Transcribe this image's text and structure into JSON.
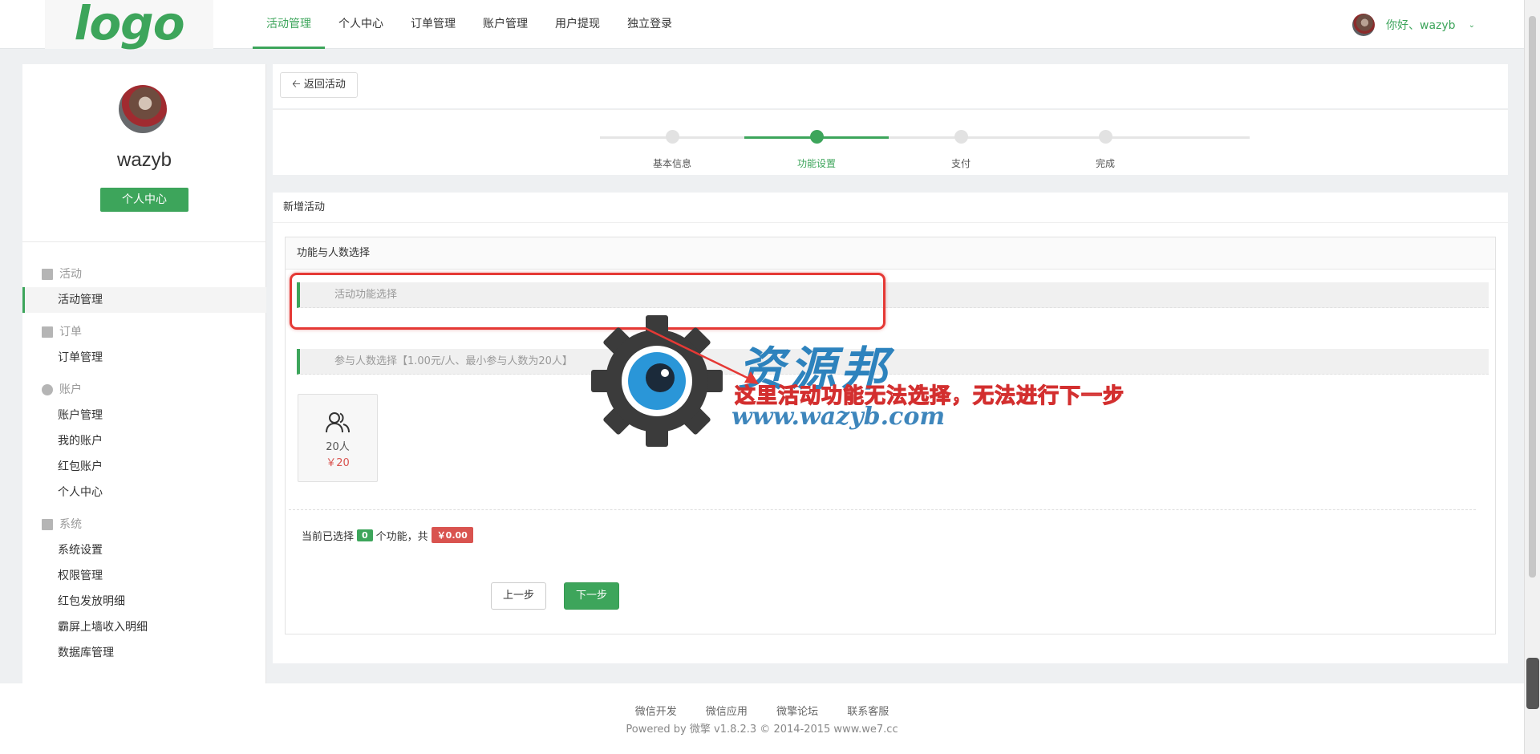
{
  "logo": "logo",
  "nav": [
    "活动管理",
    "个人中心",
    "订单管理",
    "账户管理",
    "用户提现",
    "独立登录"
  ],
  "user_greeting": "你好、wazyb",
  "profile": {
    "name": "wazyb",
    "button": "个人中心"
  },
  "sidebar": {
    "groups": [
      {
        "label": "活动",
        "items": [
          "活动管理"
        ]
      },
      {
        "label": "订单",
        "items": [
          "订单管理"
        ]
      },
      {
        "label": "账户",
        "items": [
          "账户管理",
          "我的账户",
          "红包账户",
          "个人中心"
        ]
      },
      {
        "label": "系统",
        "items": [
          "系统设置",
          "权限管理",
          "红包发放明细",
          "霸屏上墙收入明细",
          "数据库管理"
        ]
      }
    ],
    "active": "活动管理"
  },
  "back_button": "返回活动",
  "steps": [
    "基本信息",
    "功能设置",
    "支付",
    "完成"
  ],
  "current_step": 2,
  "form": {
    "title": "新增活动",
    "panel_title": "功能与人数选择",
    "section_feature": "活动功能选择",
    "section_people": "参与人数选择【1.00元/人、最小参与人数为20人】",
    "people_option": {
      "count": "20人",
      "price": "￥20"
    },
    "summary_prefix": "当前已选择",
    "summary_count": "0",
    "summary_mid": "个功能，共",
    "summary_total": "￥0.00",
    "prev_button": "上一步",
    "next_button": "下一步"
  },
  "annotation": {
    "text": "这里活动功能无法选择，无法进行下一步",
    "watermark_cn": "资源邦",
    "watermark_url": "www.wazyb.com"
  },
  "footer": {
    "links": [
      "微信开发",
      "微信应用",
      "微擎论坛",
      "联系客服"
    ],
    "copyright": "Powered by 微擎 v1.8.2.3 © 2014-2015 www.we7.cc"
  },
  "colors": {
    "accent": "#3da55b",
    "danger": "#d9534f",
    "annotation": "#e53935"
  }
}
